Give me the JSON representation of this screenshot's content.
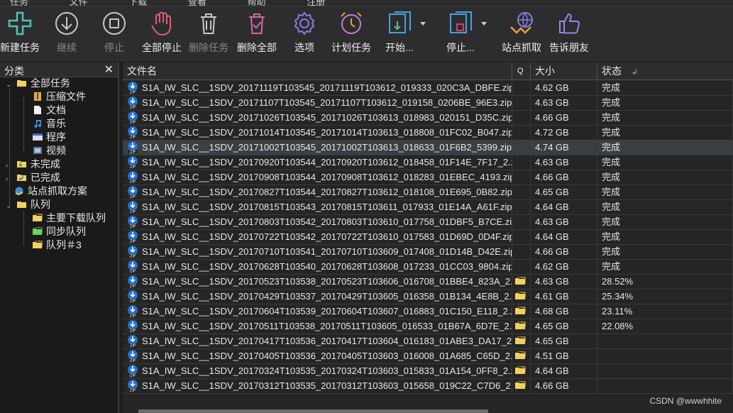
{
  "menu": [
    "任务",
    "文件",
    "下载",
    "查看",
    "帮助",
    "注册"
  ],
  "toolbar": [
    {
      "label": "新建任务",
      "icon": "plus-icon",
      "enabled": true
    },
    {
      "label": "继续",
      "icon": "resume-download-icon",
      "enabled": false
    },
    {
      "label": "停止",
      "icon": "stop-icon",
      "enabled": false
    },
    {
      "label": "全部停止",
      "icon": "hand-stop-icon",
      "enabled": true
    },
    {
      "label": "删除任务",
      "icon": "trash-icon",
      "enabled": false
    },
    {
      "label": "删除全部",
      "icon": "trash-check-icon",
      "enabled": true
    },
    {
      "label": "选项",
      "icon": "gear-icon",
      "enabled": true
    },
    {
      "label": "计划任务",
      "icon": "alarm-clock-icon",
      "enabled": true
    },
    {
      "label": "开始...",
      "icon": "queue-start-icon",
      "enabled": true
    },
    {
      "label": "停止...",
      "icon": "queue-stop-icon",
      "enabled": true
    },
    {
      "label": "站点抓取",
      "icon": "site-grabber-icon",
      "enabled": true
    },
    {
      "label": "告诉朋友",
      "icon": "thumbs-up-icon",
      "enabled": true
    }
  ],
  "sidebar": {
    "title": "分类",
    "close": "✕",
    "items": [
      {
        "label": "全部任务"
      },
      {
        "label": "压缩文件"
      },
      {
        "label": "文档"
      },
      {
        "label": "音乐"
      },
      {
        "label": "程序"
      },
      {
        "label": "视频"
      },
      {
        "label": "未完成"
      },
      {
        "label": "已完成"
      },
      {
        "label": "站点抓取方案"
      },
      {
        "label": "队列"
      },
      {
        "label": "主要下载队列"
      },
      {
        "label": "同步队列"
      },
      {
        "label": "队列＃3"
      }
    ]
  },
  "columns": {
    "name": "文件名",
    "q": "Q",
    "size": "大小",
    "status": "状态"
  },
  "files": [
    {
      "name": "S1A_IW_SLC__1SDV_20171119T103545_20171119T103612_019333_020C3A_DBFE.zip",
      "size": "4.62  GB",
      "status": "完成",
      "queued": false,
      "selected": false
    },
    {
      "name": "S1A_IW_SLC__1SDV_20171107T103545_20171107T103612_019158_0206BE_96E3.zip",
      "size": "4.63  GB",
      "status": "完成",
      "queued": false,
      "selected": false
    },
    {
      "name": "S1A_IW_SLC__1SDV_20171026T103545_20171026T103613_018983_020151_D35C.zip",
      "size": "4.66  GB",
      "status": "完成",
      "queued": false,
      "selected": false
    },
    {
      "name": "S1A_IW_SLC__1SDV_20171014T103545_20171014T103613_018808_01FC02_B047.zip",
      "size": "4.72  GB",
      "status": "完成",
      "queued": false,
      "selected": false
    },
    {
      "name": "S1A_IW_SLC__1SDV_20171002T103545_20171002T103613_018633_01F6B2_5399.zip",
      "size": "4.74  GB",
      "status": "完成",
      "queued": false,
      "selected": true
    },
    {
      "name": "S1A_IW_SLC__1SDV_20170920T103544_20170920T103612_018458_01F14E_7F17_2.zip",
      "size": "4.63  GB",
      "status": "完成",
      "queued": false,
      "selected": false
    },
    {
      "name": "S1A_IW_SLC__1SDV_20170908T103544_20170908T103612_018283_01EBEC_4193.zip",
      "size": "4.66  GB",
      "status": "完成",
      "queued": false,
      "selected": false
    },
    {
      "name": "S1A_IW_SLC__1SDV_20170827T103544_20170827T103612_018108_01E695_0B82.zip",
      "size": "4.65  GB",
      "status": "完成",
      "queued": false,
      "selected": false
    },
    {
      "name": "S1A_IW_SLC__1SDV_20170815T103543_20170815T103611_017933_01E14A_A61F.zip",
      "size": "4.64  GB",
      "status": "完成",
      "queued": false,
      "selected": false
    },
    {
      "name": "S1A_IW_SLC__1SDV_20170803T103542_20170803T103610_017758_01DBF5_B7CE.zip",
      "size": "4.63  GB",
      "status": "完成",
      "queued": false,
      "selected": false
    },
    {
      "name": "S1A_IW_SLC__1SDV_20170722T103542_20170722T103610_017583_01D69D_0D4F.zip",
      "size": "4.64  GB",
      "status": "完成",
      "queued": false,
      "selected": false
    },
    {
      "name": "S1A_IW_SLC__1SDV_20170710T103541_20170710T103609_017408_01D14B_D42E.zip",
      "size": "4.66  GB",
      "status": "完成",
      "queued": false,
      "selected": false
    },
    {
      "name": "S1A_IW_SLC__1SDV_20170628T103540_20170628T103608_017233_01CC03_9804.zip",
      "size": "4.62  GB",
      "status": "完成",
      "queued": false,
      "selected": false
    },
    {
      "name": "S1A_IW_SLC__1SDV_20170523T103538_20170523T103606_016708_01BBE4_823A_2.zip",
      "size": "4.63  GB",
      "status": "28.52%",
      "queued": true,
      "selected": false
    },
    {
      "name": "S1A_IW_SLC__1SDV_20170429T103537_20170429T103605_016358_01B134_4E8B_2.zip",
      "size": "4.61  GB",
      "status": "25.34%",
      "queued": true,
      "selected": false
    },
    {
      "name": "S1A_IW_SLC__1SDV_20170604T103539_20170604T103607_016883_01C150_E118_2.zip",
      "size": "4.68  GB",
      "status": "23.11%",
      "queued": true,
      "selected": false
    },
    {
      "name": "S1A_IW_SLC__1SDV_20170511T103538_20170511T103605_016533_01B67A_6D7E_2.zip",
      "size": "4.65  GB",
      "status": "22.08%",
      "queued": true,
      "selected": false
    },
    {
      "name": "S1A_IW_SLC__1SDV_20170417T103536_20170417T103604_016183_01ABE3_DA17_2.zip",
      "size": "4.65  GB",
      "status": "",
      "queued": true,
      "selected": false
    },
    {
      "name": "S1A_IW_SLC__1SDV_20170405T103536_20170405T103603_016008_01A685_C65D_2.zip",
      "size": "4.51  GB",
      "status": "",
      "queued": true,
      "selected": false
    },
    {
      "name": "S1A_IW_SLC__1SDV_20170324T103535_20170324T103603_015833_01A154_0FF8_2.zip",
      "size": "4.64  GB",
      "status": "",
      "queued": true,
      "selected": false
    },
    {
      "name": "S1A_IW_SLC__1SDV_20170312T103535_20170312T103603_015658_019C22_C7D6_2.zip",
      "size": "4.66  GB",
      "status": "",
      "queued": true,
      "selected": false
    }
  ],
  "watermark": "CSDN @wwwhhite",
  "colors": {
    "accent": "#3a8fd6",
    "zip_icon": "#1e6fd0",
    "folder": "#f2d060"
  }
}
